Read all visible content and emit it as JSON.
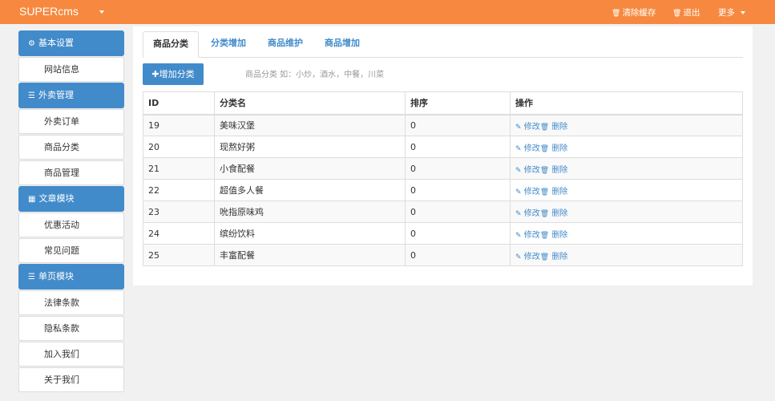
{
  "topbar": {
    "brand": "SUPERcms",
    "links": [
      {
        "icon": "trash-icon",
        "glyph": "🗑",
        "label": "清除缓存"
      },
      {
        "icon": "trash-icon",
        "glyph": "🗑",
        "label": "退出"
      },
      {
        "icon": "chevron-down-icon",
        "glyph": "",
        "label": "更多"
      }
    ]
  },
  "sidebar": {
    "sections": [
      {
        "icon": "gear-icon",
        "glyph": "⚙",
        "title": "基本设置",
        "items": [
          "网站信息"
        ]
      },
      {
        "icon": "list-icon",
        "glyph": "☰",
        "title": "外卖管理",
        "items": [
          "外卖订单",
          "商品分类",
          "商品管理"
        ]
      },
      {
        "icon": "calendar-icon",
        "glyph": "▦",
        "title": "文章模块",
        "items": [
          "优惠活动",
          "常见问题"
        ]
      },
      {
        "icon": "list-icon",
        "glyph": "☰",
        "title": "单页模块",
        "items": [
          "法律条款",
          "隐私条款",
          "加入我们",
          "关于我们"
        ]
      }
    ]
  },
  "tabs": [
    "商品分类",
    "分类增加",
    "商品维护",
    "商品增加"
  ],
  "add_button": {
    "glyph": "✚",
    "label": "增加分类"
  },
  "hint": "商品分类 如：小炒，酒水，中餐，川菜",
  "table": {
    "headers": [
      "ID",
      "分类名",
      "排序",
      "操作"
    ],
    "edit_label": "修改",
    "delete_label": "删除",
    "edit_glyph": "✎",
    "delete_glyph": "🗑",
    "rows": [
      {
        "id": "19",
        "name": "美味汉堡",
        "sort": "0"
      },
      {
        "id": "20",
        "name": "现熬好粥",
        "sort": "0"
      },
      {
        "id": "21",
        "name": "小食配餐",
        "sort": "0"
      },
      {
        "id": "22",
        "name": "超值多人餐",
        "sort": "0"
      },
      {
        "id": "23",
        "name": "吮指原味鸡",
        "sort": "0"
      },
      {
        "id": "24",
        "name": "缤纷饮料",
        "sort": "0"
      },
      {
        "id": "25",
        "name": "丰富配餐",
        "sort": "0"
      }
    ]
  },
  "colors": {
    "topbar": "#f6893f",
    "primary": "#428bca"
  }
}
